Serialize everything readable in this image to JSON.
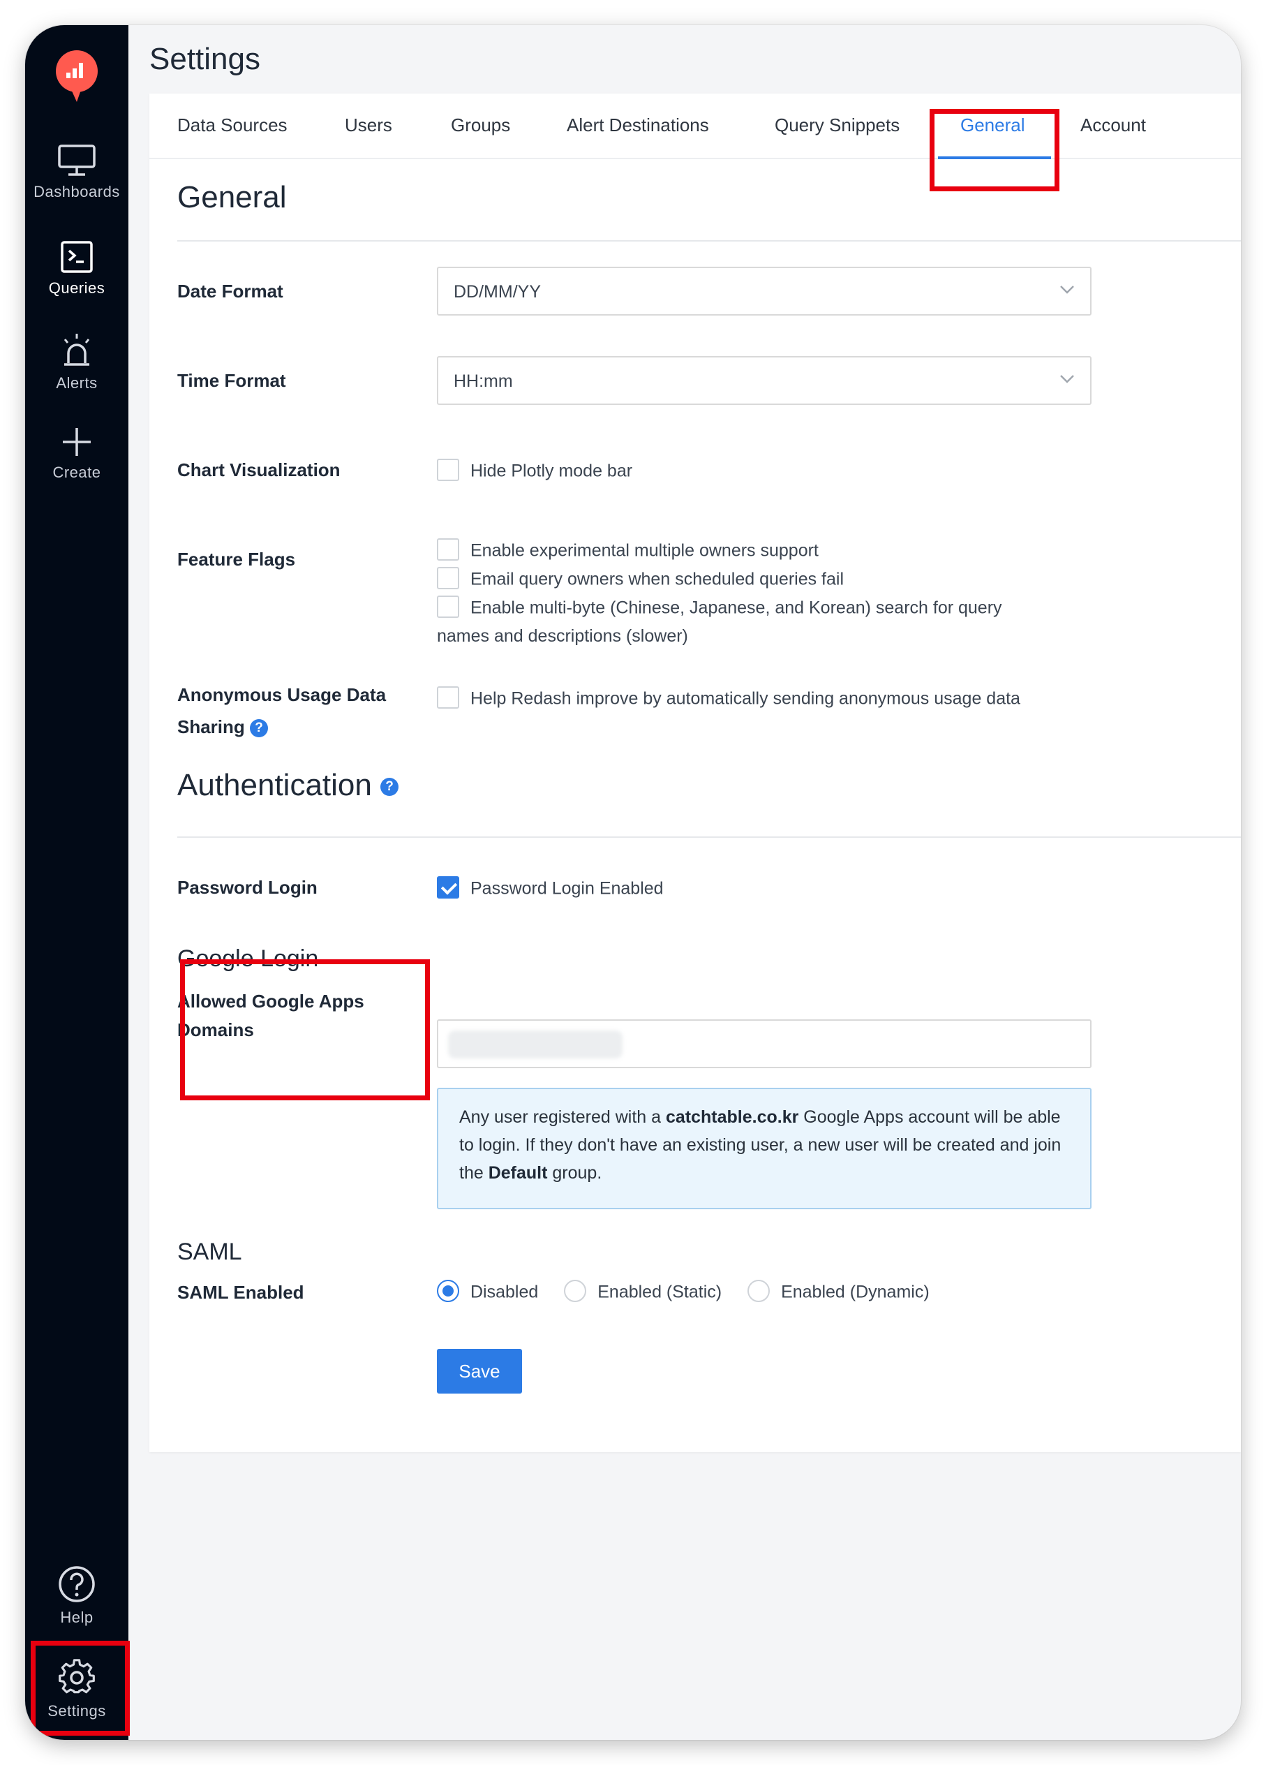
{
  "page_title": "Settings",
  "sidebar": {
    "items": [
      {
        "label": "Dashboards",
        "icon": "monitor-icon"
      },
      {
        "label": "Queries",
        "icon": "terminal-icon"
      },
      {
        "label": "Alerts",
        "icon": "alarm-icon"
      },
      {
        "label": "Create",
        "icon": "plus-icon"
      }
    ],
    "help_label": "Help",
    "settings_label": "Settings",
    "logo_color": "#ff5a4f"
  },
  "tabs": [
    {
      "label": "Data Sources"
    },
    {
      "label": "Users"
    },
    {
      "label": "Groups"
    },
    {
      "label": "Alert Destinations"
    },
    {
      "label": "Query Snippets"
    },
    {
      "label": "General",
      "active": true
    },
    {
      "label": "Account"
    }
  ],
  "general": {
    "title": "General",
    "date_format": {
      "label": "Date Format",
      "value": "DD/MM/YY"
    },
    "time_format": {
      "label": "Time Format",
      "value": "HH:mm"
    },
    "chart_visualization": {
      "label": "Chart Visualization",
      "option": "Hide Plotly mode bar",
      "checked": false
    },
    "feature_flags": {
      "label": "Feature Flags",
      "options": [
        {
          "text": "Enable experimental multiple owners support",
          "checked": false
        },
        {
          "text": "Email query owners when scheduled queries fail",
          "checked": false
        },
        {
          "text": "Enable multi-byte (Chinese, Japanese, and Korean) search for query",
          "checked": false
        }
      ],
      "option3_continued": "names and descriptions (slower)"
    },
    "anonymous_usage": {
      "label_line1": "Anonymous Usage Data",
      "label_line2": "Sharing",
      "option": "Help Redash improve by automatically sending anonymous usage data",
      "checked": false
    }
  },
  "authentication": {
    "title": "Authentication",
    "password_login": {
      "label": "Password Login",
      "option": "Password Login Enabled",
      "checked": true
    },
    "google_login": {
      "title": "Google Login",
      "label_line1": "Allowed Google Apps",
      "label_line2": "Domains",
      "info_prefix": "Any user registered with a ",
      "info_domain": "catchtable.co.kr",
      "info_middle": " Google Apps account will be able to login. If they don't have an existing user, a new user will be created and join the ",
      "info_group": "Default",
      "info_suffix": " group."
    },
    "saml": {
      "title": "SAML",
      "label": "SAML Enabled",
      "options": [
        "Disabled",
        "Enabled (Static)",
        "Enabled (Dynamic)"
      ],
      "selected": "Disabled"
    }
  },
  "save_label": "Save",
  "colors": {
    "accent": "#2c7be5",
    "highlight": "#e8000f",
    "sidebar_bg": "#020a17"
  }
}
